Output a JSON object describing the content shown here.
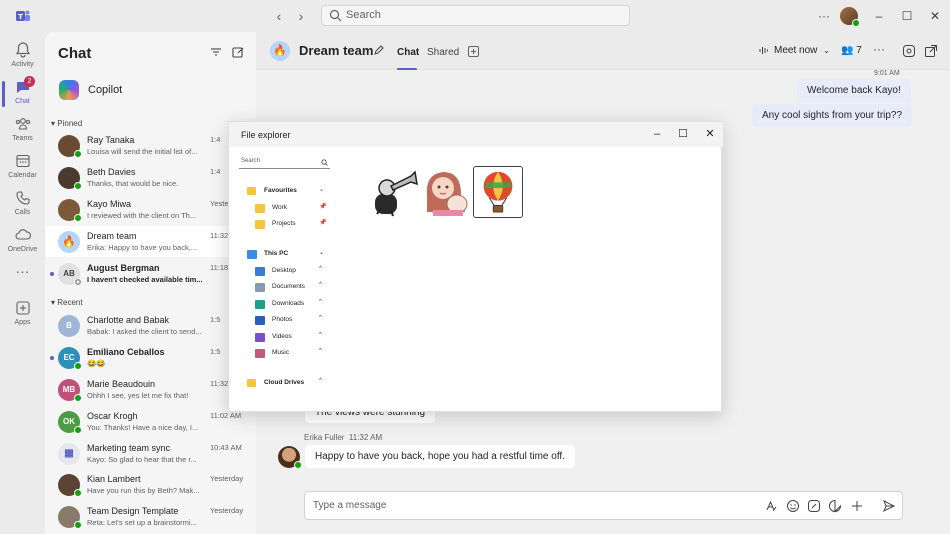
{
  "titlebar": {
    "search_placeholder": "Search"
  },
  "rail": {
    "items": [
      {
        "label": "Activity",
        "icon": "bell-icon"
      },
      {
        "label": "Chat",
        "icon": "chat-icon",
        "badge": "2"
      },
      {
        "label": "Teams",
        "icon": "teams-icon"
      },
      {
        "label": "Calendar",
        "icon": "calendar-icon"
      },
      {
        "label": "Calls",
        "icon": "phone-icon"
      },
      {
        "label": "OneDrive",
        "icon": "cloud-icon"
      },
      {
        "label": "Apps",
        "icon": "add-apps-icon"
      }
    ]
  },
  "chat_list": {
    "title": "Chat",
    "copilot_label": "Copilot",
    "pinned_label": "Pinned",
    "recent_label": "Recent",
    "pinned": [
      {
        "name": "Ray Tanaka",
        "preview": "Louisa will send the initial list of...",
        "time": "1:4",
        "initials": "",
        "color": "#6b4a32"
      },
      {
        "name": "Beth Davies",
        "preview": "Thanks, that would be nice.",
        "time": "1:4",
        "initials": "",
        "color": "#4a3b2e"
      },
      {
        "name": "Kayo Miwa",
        "preview": "I reviewed with the client on Th...",
        "time": "Yeste",
        "initials": "",
        "color": "#7a5a3a"
      },
      {
        "name": "Dream team",
        "preview": "Erika: Happy to have you back,...",
        "time": "11:32",
        "initials": "",
        "color": "#b4d6fa"
      },
      {
        "name": "August Bergman",
        "preview": "I haven't checked available tim...",
        "time": "11:18",
        "initials": "AB",
        "color": "#e0e0e0"
      }
    ],
    "recent": [
      {
        "name": "Charlotte and Babak",
        "preview": "Babak: I asked the client to send...",
        "time": "1:5",
        "initials": "B",
        "color": "#9fb6d6"
      },
      {
        "name": "Emiliano Ceballos",
        "preview": "😂😂",
        "time": "1:5",
        "initials": "EC",
        "color": "#2e8fb8"
      },
      {
        "name": "Marie Beaudouin",
        "preview": "Ohhh I see, yes let me fix that!",
        "time": "11:32",
        "initials": "MB",
        "color": "#c24e7a"
      },
      {
        "name": "Oscar Krogh",
        "preview": "You: Thanks! Have a nice day, I...",
        "time": "11:02 AM",
        "initials": "OK",
        "color": "#4e9b46"
      },
      {
        "name": "Marketing team sync",
        "preview": "Kayo: So glad to hear that the r...",
        "time": "10:43 AM",
        "initials": "",
        "color": "#e6e6ef"
      },
      {
        "name": "Kian Lambert",
        "preview": "Have you run this by Beth? Mak...",
        "time": "Yesterday",
        "initials": "",
        "color": "#5a4433"
      },
      {
        "name": "Team Design Template",
        "preview": "Reta: Let's set up a brainstormi...",
        "time": "Yesterday",
        "initials": "",
        "color": "#8a7a6a"
      }
    ]
  },
  "main": {
    "group_name": "Dream team",
    "tabs": [
      "Chat",
      "Shared"
    ],
    "meet_now_label": "Meet now",
    "participants_count": "7",
    "top_time": "9:01 AM",
    "my_messages": [
      "Welcome back Kayo!",
      "Any cool sights from your trip??"
    ],
    "partial_message": "The views were stunning",
    "sender": "Erika Fuller",
    "sent_time": "11:32 AM",
    "reply": "Happy to have you back, hope you had a restful time off.",
    "composer_placeholder": "Type a message"
  },
  "file_explorer": {
    "title": "File explorer",
    "search_placeholder": "Search",
    "favourites_label": "Favourites",
    "favourites": [
      "Work",
      "Projects"
    ],
    "this_pc_label": "This PC",
    "this_pc": [
      "Desktop",
      "Documents",
      "Downloads",
      "Photos",
      "Videos",
      "Music"
    ],
    "cloud_label": "Cloud Drives",
    "thumbnails": [
      "trumpet-sticker-image",
      "girl-with-cat-sticker-image",
      "hot-air-balloon-sticker-image"
    ]
  },
  "colors": {
    "accent": "#5b5fc7",
    "presence": "#13a10e",
    "badge": "#c4314b"
  }
}
